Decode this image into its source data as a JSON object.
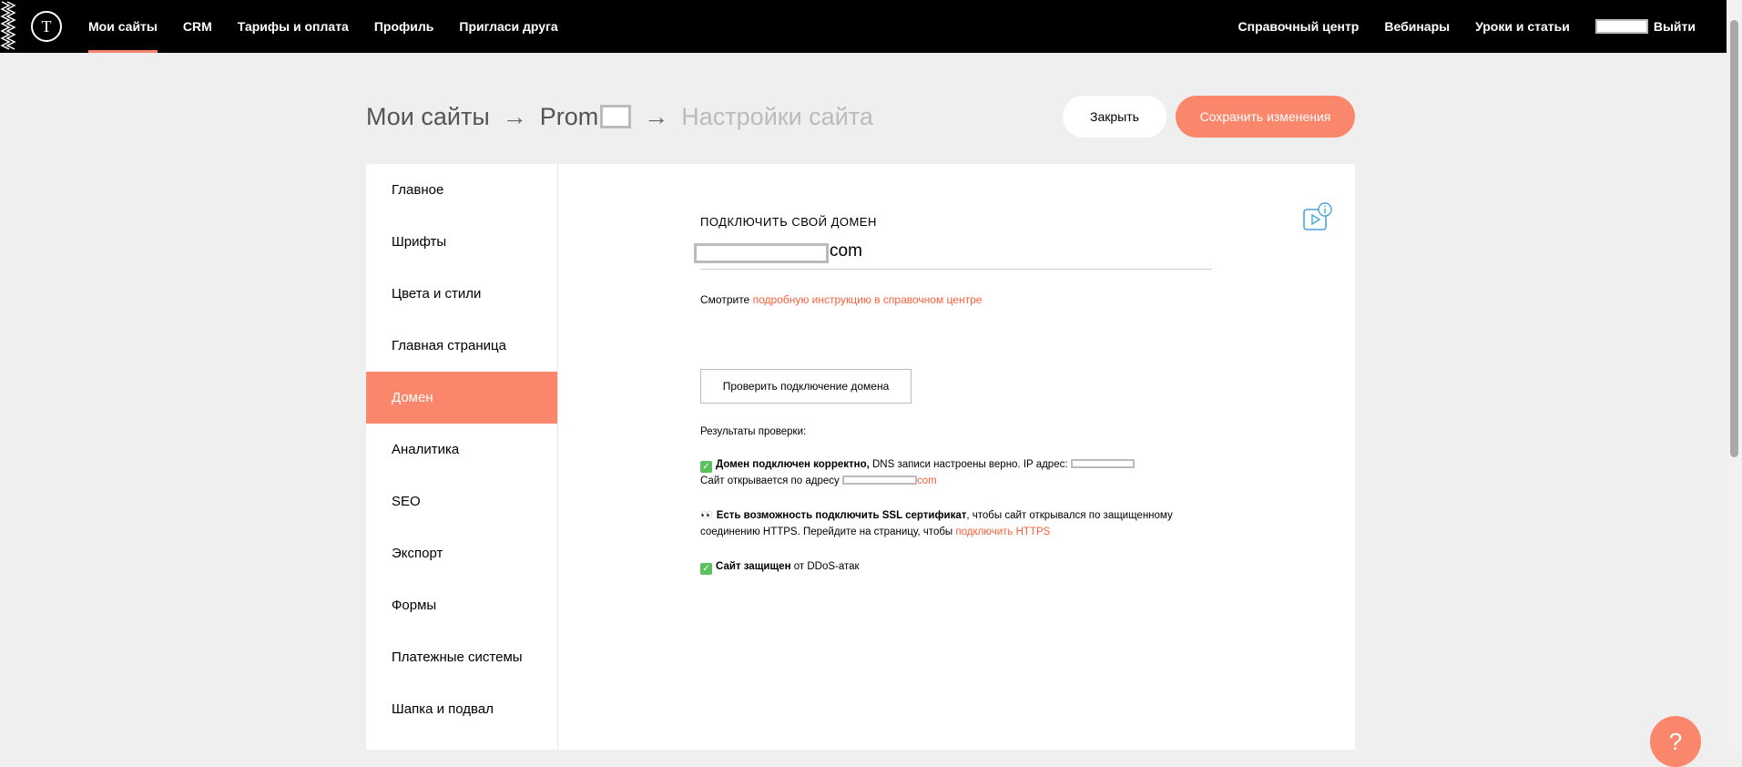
{
  "topbar": {
    "logo_letter": "T",
    "nav_left": [
      "Мои сайты",
      "CRM",
      "Тарифы и оплата",
      "Профиль",
      "Пригласи друга"
    ],
    "nav_right": [
      "Справочный центр",
      "Вебинары",
      "Уроки и статьи"
    ],
    "logout": "Выйти"
  },
  "header": {
    "crumb_root": "Мои сайты",
    "arrow": "→",
    "crumb_site": "Prom",
    "crumb_current": "Настройки сайта",
    "close_label": "Закрыть",
    "save_label": "Сохранить изменения"
  },
  "sidebar": {
    "items": [
      "Главное",
      "Шрифты",
      "Цвета и стили",
      "Главная страница",
      "Домен",
      "Аналитика",
      "SEO",
      "Экспорт",
      "Формы",
      "Платежные системы",
      "Шапка и подвал"
    ],
    "active": "Домен"
  },
  "domain": {
    "title": "ПОДКЛЮЧИТЬ СВОЙ ДОМЕН",
    "suffix": "com",
    "hint_prefix": "Смотрите",
    "hint_link": "подробную инструкцию в справочном центре",
    "check_button": "Проверить подключение домена"
  },
  "results": {
    "heading": "Результаты проверки:",
    "r1_bold": "Домен подключен корректно,",
    "r1_text": "DNS записи настроены верно. IP адрес:",
    "r1_line2": "Сайт открывается по адресу",
    "r1_link_suffix": "com",
    "r2_bold": "Есть возможность подключить SSL сертификат",
    "r2_text": ", чтобы сайт открывался по защищенному соединению HTTPS. Перейдите на страницу, чтобы",
    "r2_link": "подключить HTTPS",
    "r3_bold": "Сайт защищен",
    "r3_text": "от DDoS-атак"
  },
  "help": {
    "label": "?"
  },
  "colors": {
    "accent": "#fa876b",
    "link": "#fa5f3b",
    "check": "#5bc05e"
  }
}
